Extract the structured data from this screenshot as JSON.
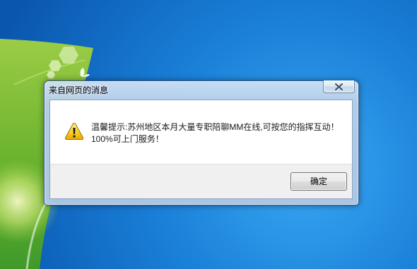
{
  "dialog": {
    "title": "来自网页的消息",
    "message": [
      "温馨提示:苏州地区本月大量专职陪聊MM在线,可按您的指挥互动！",
      "100%可上门服务！"
    ],
    "ok_button_label": "确定"
  },
  "icons": {
    "close": "close-icon",
    "warning": "warning-icon"
  },
  "colors": {
    "desktop_blue": "#1a7fd6",
    "frame_glass": "#b6cee9",
    "content_bg": "#ffffff",
    "footer_bg": "#f0f0f0",
    "warning_yellow": "#f5c518"
  }
}
